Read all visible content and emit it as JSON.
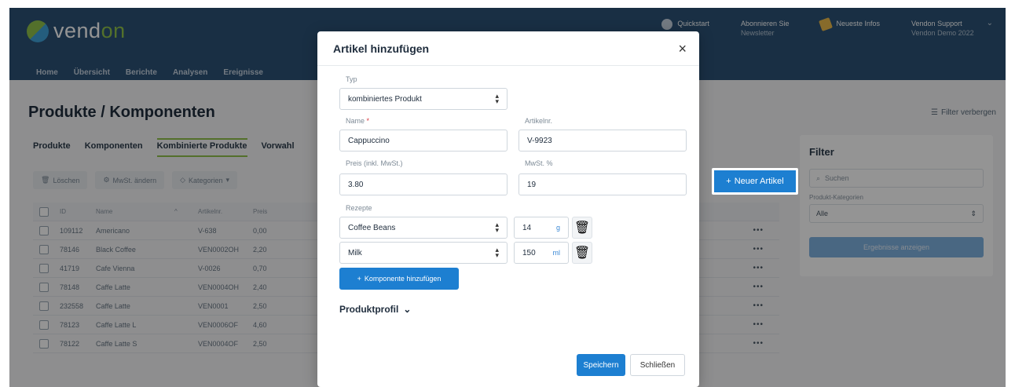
{
  "header": {
    "logo_left": "vend",
    "logo_accent": "on",
    "nav": [
      "Home",
      "Übersicht",
      "Berichte",
      "Analysen",
      "Ereignisse"
    ],
    "quickstart": "Quickstart",
    "subscribe": "Abonnieren Sie",
    "subscribe_sub": "Newsletter",
    "news": "Neueste Infos",
    "user_name": "Vendon Support",
    "user_sub": "Vendon Demo 2022"
  },
  "page": {
    "title": "Produkte / Komponenten",
    "filter_toggle": "Filter verbergen",
    "tabs": [
      "Produkte",
      "Komponenten",
      "Kombinierte Produkte",
      "Vorwahl"
    ],
    "toolbar": {
      "delete": "Löschen",
      "vat": "MwSt. ändern",
      "categories": "Kategorien"
    },
    "new_item": "Neuer Artikel"
  },
  "table": {
    "headers": {
      "id": "ID",
      "name": "Name",
      "nr": "Artikelnr.",
      "price": "Preis"
    },
    "rows": [
      {
        "id": "109112",
        "name": "Americano",
        "nr": "V-638",
        "price": "0,00"
      },
      {
        "id": "78146",
        "name": "Black Coffee",
        "nr": "VEN0002OH",
        "price": "2,20"
      },
      {
        "id": "41719",
        "name": "Cafe Vienna",
        "nr": "V-0026",
        "price": "0,70"
      },
      {
        "id": "78148",
        "name": "Caffe Latte",
        "nr": "VEN0004OH",
        "price": "2,40"
      },
      {
        "id": "232558",
        "name": "Caffe Latte",
        "nr": "VEN0001",
        "price": "2,50"
      },
      {
        "id": "78123",
        "name": "Caffe Latte L",
        "nr": "VEN0006OF",
        "price": "4,60"
      },
      {
        "id": "78122",
        "name": "Caffe Latte S",
        "nr": "VEN0004OF",
        "price": "2,50"
      }
    ]
  },
  "filter": {
    "title": "Filter",
    "search_placeholder": "Suchen",
    "category_label": "Produkt-Kategorien",
    "category_value": "Alle",
    "apply": "Ergebnisse anzeigen"
  },
  "modal": {
    "title": "Artikel hinzufügen",
    "type_label": "Typ",
    "type_value": "kombiniertes Produkt",
    "name_label": "Name",
    "name_value": "Cappuccino",
    "nr_label": "Artikelnr.",
    "nr_value": "V-9923",
    "price_label": "Preis (inkl. MwSt.)",
    "price_value": "3.80",
    "vat_label": "MwSt. %",
    "vat_value": "19",
    "recipes_label": "Rezepte",
    "recipes": [
      {
        "component": "Coffee Beans",
        "qty": "14",
        "unit": "g"
      },
      {
        "component": "Milk",
        "qty": "150",
        "unit": "ml"
      }
    ],
    "add_component": "Komponente hinzufügen",
    "profile": "Produktprofil",
    "save": "Speichern",
    "close": "Schließen"
  },
  "colors": {
    "header": "#2b5276",
    "primary": "#1d7fd1",
    "brand_green": "#8fc24a"
  }
}
